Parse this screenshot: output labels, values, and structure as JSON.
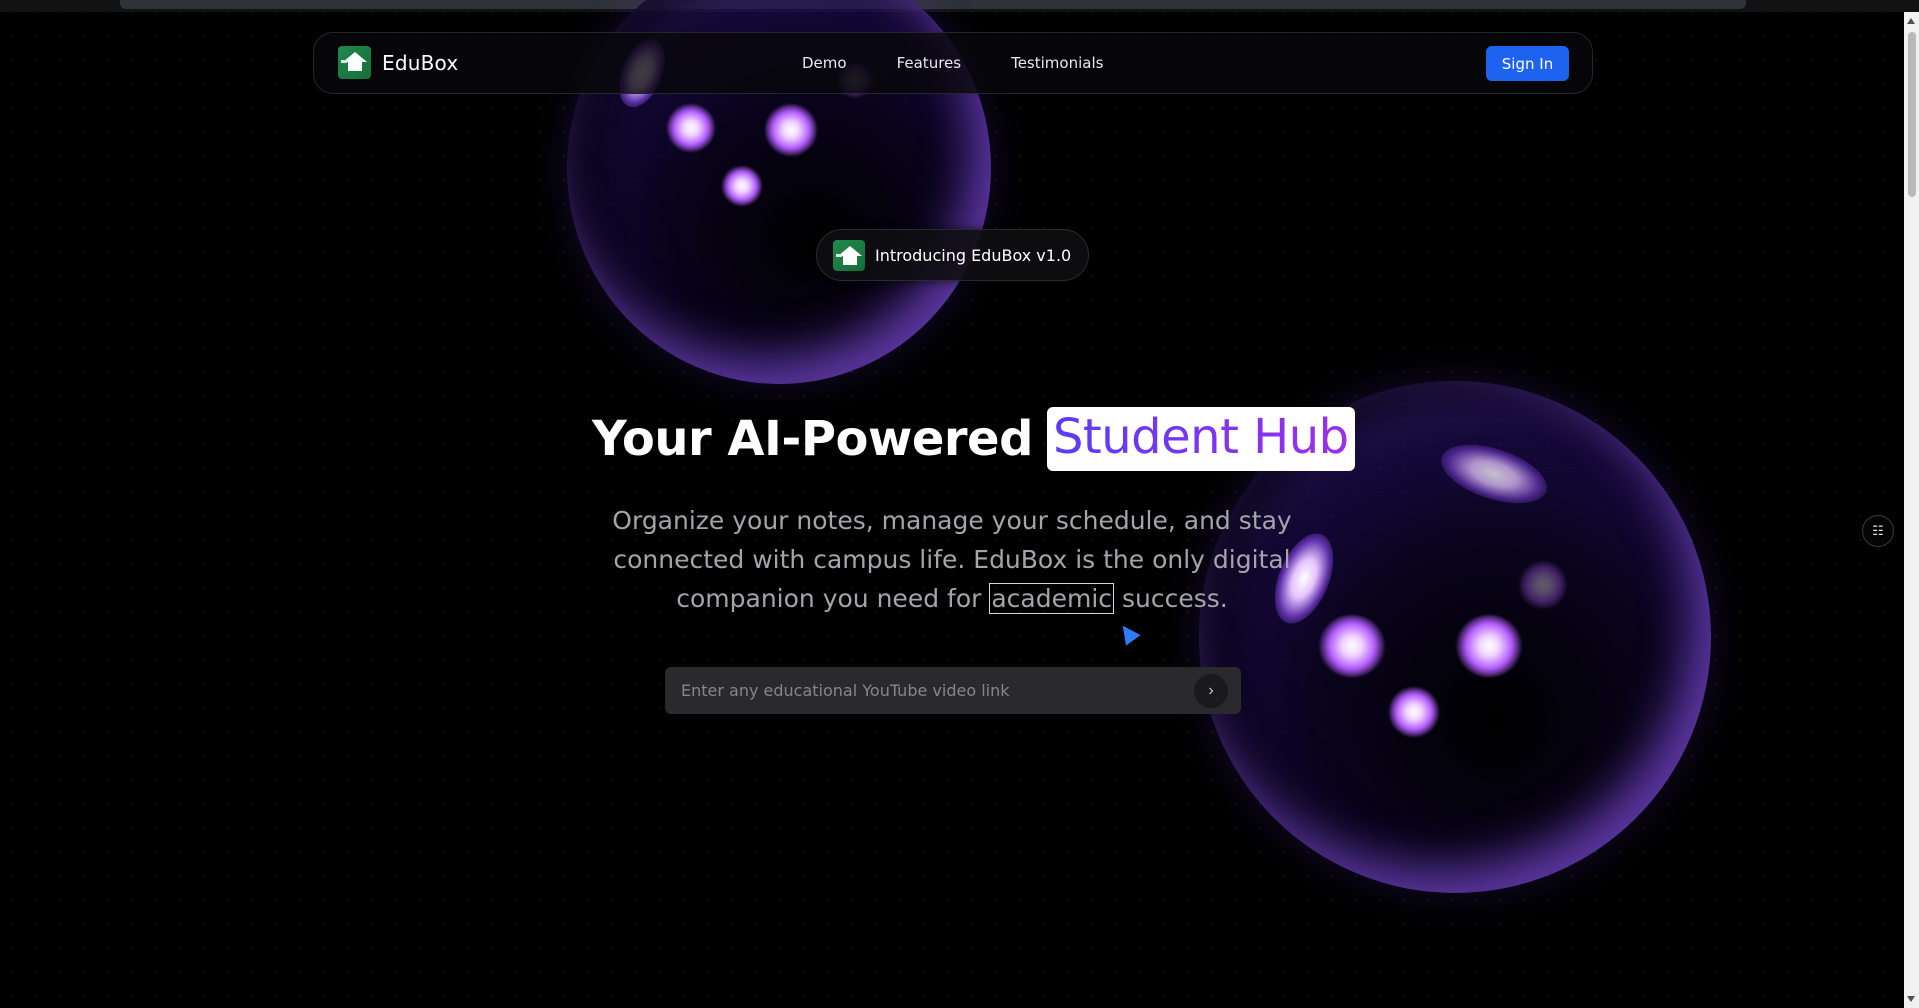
{
  "nav": {
    "brand": "EduBox",
    "links": [
      "Demo",
      "Features",
      "Testimonials"
    ],
    "signin_label": "Sign In"
  },
  "intro_badge": "Introducing EduBox v1.0",
  "hero": {
    "title_prefix": "Your AI-Powered",
    "title_highlight": "Student Hub",
    "subtitle_line1": "Organize your notes, manage your schedule, and stay",
    "subtitle_line2": "connected with campus life. EduBox is the only digital",
    "subtitle_line3_before": "companion you need for",
    "subtitle_boxed_word": "academic",
    "subtitle_line3_after": "success."
  },
  "video_input": {
    "placeholder": "Enter any educational YouTube video link",
    "value": "",
    "submit_icon": "chevron-right-icon"
  },
  "side_widget_icon": "toggle-list-icon",
  "colors": {
    "background": "#000000",
    "accent_button": "#1e63f0",
    "highlight_gradient_start": "#5b3cf5",
    "highlight_gradient_end": "#9d2fe8",
    "sphere_glow": "#b35cff",
    "cursor": "#2f7cf6"
  }
}
